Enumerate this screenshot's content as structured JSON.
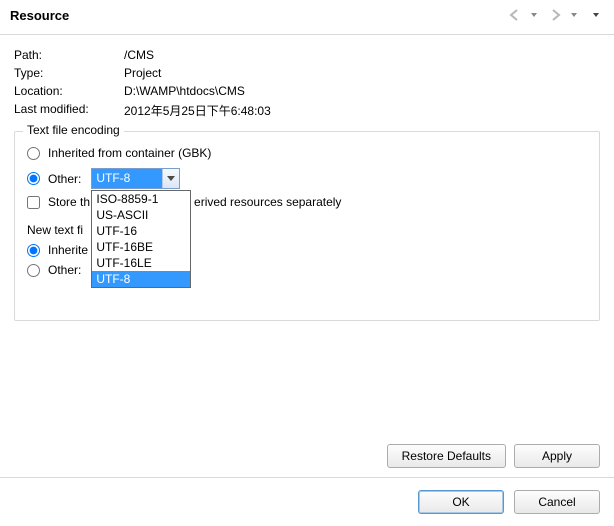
{
  "header": {
    "title": "Resource"
  },
  "meta": {
    "path_label": "Path:",
    "path_value": "/CMS",
    "type_label": "Type:",
    "type_value": "Project",
    "location_label": "Location:",
    "location_value": "D:\\WAMP\\htdocs\\CMS",
    "lastmod_label": "Last modified:",
    "lastmod_value": "2012年5月25日下午6:48:03"
  },
  "encoding_group": {
    "legend": "Text file encoding",
    "inherited_label": "Inherited from container (GBK)",
    "other_label": "Other:",
    "other_value": "UTF-8",
    "store_label_a": "Store th",
    "store_label_b": "erived resources separately",
    "dropdown_items": [
      "ISO-8859-1",
      "US-ASCII",
      "UTF-16",
      "UTF-16BE",
      "UTF-16LE",
      "UTF-8"
    ],
    "dropdown_selected_index": 5
  },
  "delim_group": {
    "legend_a": "New text fi",
    "inherited_label_a": "Inherite",
    "other_label": "Other:"
  },
  "buttons": {
    "restore": "Restore Defaults",
    "apply": "Apply",
    "ok": "OK",
    "cancel": "Cancel"
  }
}
